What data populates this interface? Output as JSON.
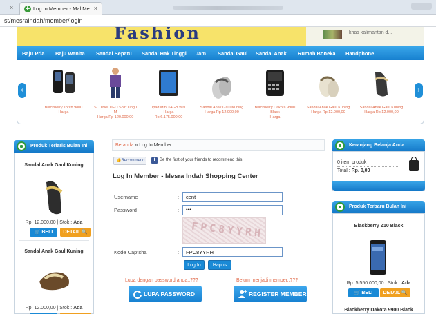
{
  "browser": {
    "tab_title": "Log In Member - Mal Me",
    "tab_close": "×",
    "left_close": "×",
    "url": "st/mesraindah/member/login"
  },
  "header": {
    "brand": "Fashion",
    "promo_text": "khas kalimantan d..."
  },
  "nav": {
    "items": [
      "Baju Pria",
      "Baju Wanita",
      "Sandal Sepatu",
      "Sandal Hak Tinggi",
      "Jam",
      "Sandal Gaul",
      "Sandal Anak",
      "Rumah Boneka",
      "Handphone"
    ]
  },
  "carousel": {
    "prev": "‹",
    "next": "›",
    "items": [
      {
        "name": "Blackberry Torch 9800",
        "price": "Harga"
      },
      {
        "name": "S. Oliver DEO Shirt Ungu M",
        "price": "Harga Rp 120.000,00"
      },
      {
        "name": "Ipad Mini 64GB Wifi Harga",
        "price": "Rp 6.175.000,00"
      },
      {
        "name": "Sandal Anak Gaul Kuning",
        "price": "Harga Rp 12.000,00"
      },
      {
        "name": "Blackberry Dakota 9900 Black",
        "price": "Harga"
      },
      {
        "name": "Sandal Anak Gaul Kuning",
        "price": "Harga Rp 12.000,00"
      },
      {
        "name": "Sandal Anak Gaul Kuning",
        "price": "Harga Rp 12.000,00"
      }
    ]
  },
  "left_panel": {
    "title": "Produk Terlaris Bulan Ini",
    "products": [
      {
        "name": "Sandal Anak Gaul Kuning",
        "price": "Rp. 12.000,00 | Stok : ",
        "stock": "Ada"
      },
      {
        "name": "Sandal Anak Gaul Kuning",
        "price": "Rp. 12.000,00 | Stok : ",
        "stock": "Ada"
      }
    ],
    "beli_label": "BELI",
    "detail_label": "DETAIL"
  },
  "main": {
    "breadcrumb_home": "Beranda",
    "breadcrumb_sep": " » ",
    "breadcrumb_current": "Log In Member",
    "recommend_label": "Recommend",
    "recommend_text": "Be the first of your friends to recommend this.",
    "heading": "Log In Member - Mesra Indah Shopping Center",
    "username_label": "Username",
    "username_value": "cent",
    "password_label": "Password",
    "password_value": "•••",
    "captcha_label": "Kode Captcha",
    "captcha_image_text": "FPC8YYRH",
    "captcha_value": "FPC8YYRH",
    "colon": ":",
    "login_button": "Log In",
    "reset_button": "Hapus",
    "forgot_hint": "Lupa dengan password anda..???",
    "register_hint": "Belum menjadi member..???",
    "forgot_button": "LUPA PASSWORD",
    "register_button": "REGISTER MEMBER"
  },
  "cart": {
    "title": "Keranjang Belanja Anda",
    "items": "0 item produk",
    "total_label": "Total : ",
    "total_value": "Rp. 0,00"
  },
  "right_panel": {
    "title": "Produk Terbaru Bulan Ini",
    "products": [
      {
        "name": "Blackberry Z10 Black",
        "price": "Rp. 5.550.000,00 | Stok : ",
        "stock": "Ada"
      },
      {
        "name": "Blackberry Dakota 9900 Black"
      }
    ],
    "beli_label": "BELI",
    "detail_label": "DETAIL"
  },
  "colors": {
    "nav_blue": "#1780cf",
    "banner_yellow": "#f7e36a",
    "link_orange": "#e06a4a",
    "detail_orange": "#f0a020"
  }
}
